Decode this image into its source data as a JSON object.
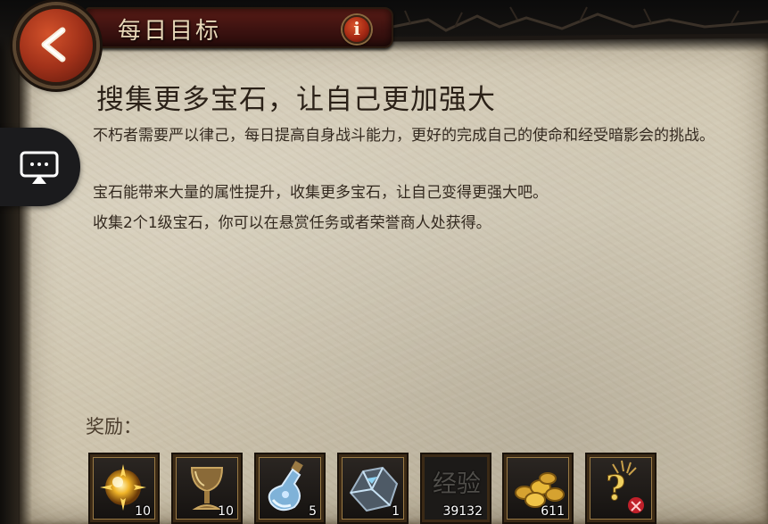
{
  "header": {
    "title": "每日目标",
    "back_icon": "back-arrow-icon",
    "info_label": "i"
  },
  "task": {
    "headline": "搜集更多宝石，让自己更加强大",
    "paragraphs": [
      "不朽者需要严以律己，每日提高自身战斗能力，更好的完成自己的使命和经受暗影会的挑战。",
      "宝石能带来大量的属性提升，收集更多宝石，让自己变得更强大吧。",
      "收集2个1级宝石，你可以在悬赏任务或者荣誉商人处获得。"
    ]
  },
  "rewards": {
    "label": "奖励：",
    "items": [
      {
        "icon": "golden-orb-icon",
        "count": "10"
      },
      {
        "icon": "chalice-icon",
        "count": "10"
      },
      {
        "icon": "potion-bottle-icon",
        "count": "5"
      },
      {
        "icon": "crystal-ore-icon",
        "count": "1"
      },
      {
        "icon": "experience-icon",
        "text": "经验",
        "count": "39132"
      },
      {
        "icon": "gold-coins-icon",
        "count": "611"
      },
      {
        "icon": "mystery-reward-icon",
        "count": ""
      }
    ]
  },
  "overlay": {
    "icon": "screen-mirror-icon"
  },
  "colors": {
    "parchment": "#d3cab5",
    "title_bar": "#4a1612",
    "back_button": "#b23a1d",
    "text": "#33291f"
  }
}
